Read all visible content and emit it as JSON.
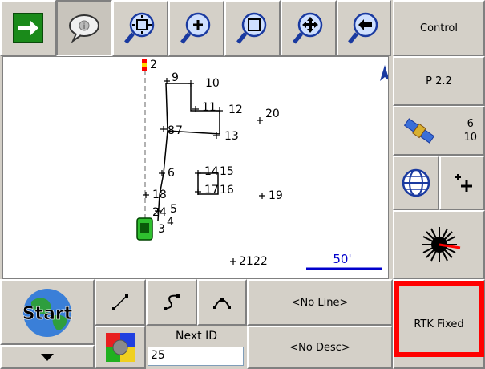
{
  "toolbar": {
    "control_label": "Control",
    "buttons": [
      "go-arrow",
      "info-bubble",
      "zoom-extents",
      "zoom-in",
      "zoom-window",
      "pan",
      "zoom-previous"
    ]
  },
  "side": {
    "point_label": "P 2.2",
    "sat_count_top": "6",
    "sat_count_bottom": "10",
    "rtk_label": "RTK Fixed"
  },
  "map": {
    "scale_label": "50'",
    "points": [
      {
        "id": "2",
        "label": "2"
      },
      {
        "id": "9",
        "label": "9"
      },
      {
        "id": "10",
        "label": "10"
      },
      {
        "id": "11",
        "label": "11"
      },
      {
        "id": "12",
        "label": "12"
      },
      {
        "id": "20",
        "label": "20"
      },
      {
        "id": "8",
        "label": "8"
      },
      {
        "id": "7",
        "label": "7"
      },
      {
        "id": "13",
        "label": "13"
      },
      {
        "id": "6",
        "label": "6"
      },
      {
        "id": "14",
        "label": "14"
      },
      {
        "id": "15",
        "label": "15"
      },
      {
        "id": "17",
        "label": "17"
      },
      {
        "id": "16",
        "label": "16"
      },
      {
        "id": "18",
        "label": "18"
      },
      {
        "id": "19",
        "label": "19"
      },
      {
        "id": "24",
        "label": "24"
      },
      {
        "id": "5",
        "label": "5"
      },
      {
        "id": "3",
        "label": "3"
      },
      {
        "id": "4",
        "label": "4"
      },
      {
        "id": "21",
        "label": "21"
      },
      {
        "id": "22",
        "label": "22"
      }
    ]
  },
  "bottom": {
    "start_label": "Start",
    "no_line_label": "<No Line>",
    "no_desc_label": "<No Desc>",
    "next_id_label": "Next ID",
    "next_id_value": "25"
  },
  "colors": {
    "accent_red": "#ff0000",
    "scale_blue": "#0000cc",
    "go_green": "#1a8a1a"
  }
}
